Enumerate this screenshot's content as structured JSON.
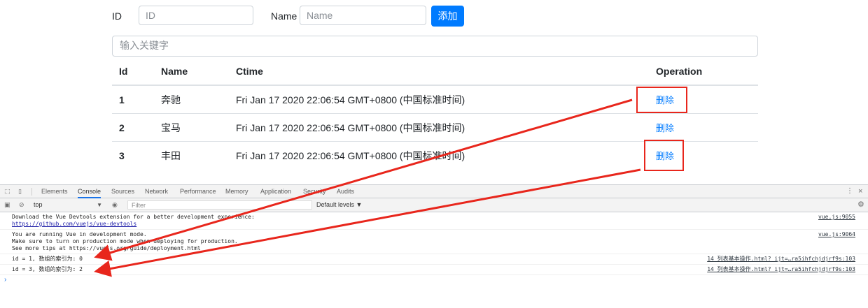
{
  "form": {
    "id_label": "ID",
    "id_placeholder": "ID",
    "name_label": "Name",
    "name_placeholder": "Name",
    "add_label": "添加"
  },
  "search": {
    "placeholder": "输入关键字"
  },
  "table": {
    "headers": [
      "Id",
      "Name",
      "Ctime",
      "Operation"
    ],
    "rows": [
      {
        "id": "1",
        "name": "奔驰",
        "ctime": "Fri Jan 17 2020 22:06:54 GMT+0800 (中国标准时间)",
        "op": "删除"
      },
      {
        "id": "2",
        "name": "宝马",
        "ctime": "Fri Jan 17 2020 22:06:54 GMT+0800 (中国标准时间)",
        "op": "删除"
      },
      {
        "id": "3",
        "name": "丰田",
        "ctime": "Fri Jan 17 2020 22:06:54 GMT+0800 (中国标准时间)",
        "op": "删除"
      }
    ]
  },
  "devtools": {
    "tabs": [
      "Elements",
      "Console",
      "Sources",
      "Network",
      "Performance",
      "Memory",
      "Application",
      "Security",
      "Audits"
    ],
    "active_tab": "Console",
    "context": "top",
    "filter_placeholder": "Filter",
    "levels": "Default levels ▼",
    "messages": [
      {
        "lines": [
          "Download the Vue Devtools extension for a better development experience:",
          "https://github.com/vuejs/vue-devtools"
        ],
        "source": "vue.js:9055"
      },
      {
        "lines": [
          "You are running Vue in development mode.",
          "Make sure to turn on production mode when deploying for production.",
          "See more tips at https://vuejs.org/guide/deployment.html"
        ],
        "source": "vue.js:9064"
      },
      {
        "lines": [
          "id = 1, 数组的索引为: 0"
        ],
        "source": "14 列表基本操作.html?_ijt=…ra5ihfchjdjrf9s:103"
      },
      {
        "lines": [
          "id = 3, 数组的索引为: 2"
        ],
        "source": "14 列表基本操作.html?_ijt=…ra5ihfchjdjrf9s:103"
      }
    ]
  },
  "colors": {
    "primary": "#007bff",
    "annotation": "#e8261c"
  }
}
